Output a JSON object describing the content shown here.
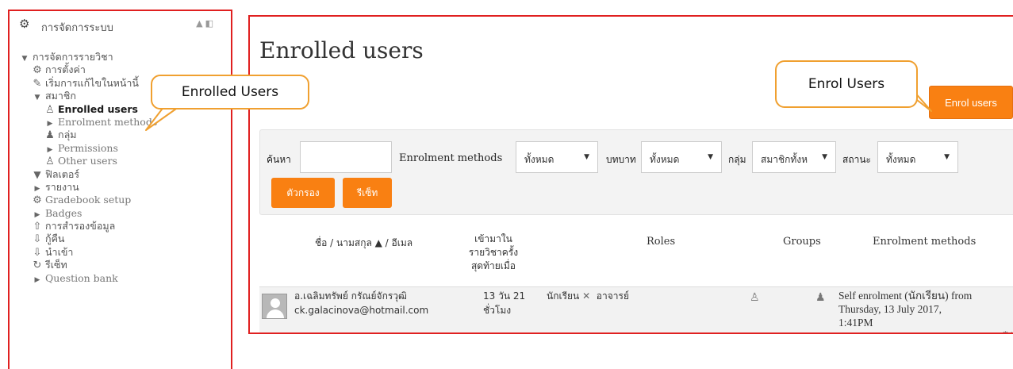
{
  "admin_panel": {
    "title": "การจัดการระบบ",
    "tree": [
      {
        "label": "การจัดการรายวิชา",
        "icon": "caret-down-icon",
        "level": 1
      },
      {
        "label": "การตั้งค่า",
        "icon": "gear-icon",
        "level": 2
      },
      {
        "label": "เริ่มการแก้ไขในหน้านี้",
        "icon": "pencil-icon",
        "level": 2
      },
      {
        "label": "สมาชิก",
        "icon": "caret-down-icon",
        "level": 2
      },
      {
        "label": "Enrolled users",
        "icon": "user-icon",
        "level": 3,
        "active": true
      },
      {
        "label": "Enrolment methods",
        "icon": "caret-right-icon",
        "level": 3
      },
      {
        "label": "กลุ่ม",
        "icon": "group-icon",
        "level": 3
      },
      {
        "label": "Permissions",
        "icon": "caret-right-icon",
        "level": 3
      },
      {
        "label": "Other users",
        "icon": "user-icon",
        "level": 3
      },
      {
        "label": "ฟิลเตอร์",
        "icon": "filter-icon",
        "level": 2
      },
      {
        "label": "รายงาน",
        "icon": "caret-right-icon",
        "level": 2
      },
      {
        "label": "Gradebook setup",
        "icon": "gear-icon",
        "level": 2
      },
      {
        "label": "Badges",
        "icon": "caret-right-icon",
        "level": 2
      },
      {
        "label": "การสำรองข้อมูล",
        "icon": "upload-icon",
        "level": 2
      },
      {
        "label": "กู้คืน",
        "icon": "download-icon",
        "level": 2
      },
      {
        "label": "นำเข้า",
        "icon": "download-icon",
        "level": 2
      },
      {
        "label": "รีเซ็ท",
        "icon": "reset-icon",
        "level": 2
      },
      {
        "label": "Question bank",
        "icon": "caret-right-icon",
        "level": 2
      }
    ]
  },
  "callouts": {
    "enrolled_users": "Enrolled Users",
    "enrol_users": "Enrol Users"
  },
  "main": {
    "title": "Enrolled users",
    "enrol_button": "Enrol users",
    "filters": {
      "search_label": "ค้นหา",
      "search_value": "",
      "methods_label": "Enrolment methods",
      "methods_value": "ทั้งหมด",
      "role_label": "บทบาท",
      "role_value": "ทั้งหมด",
      "group_label": "กลุ่ม",
      "group_value": "สมาชิกทั้งห",
      "status_label": "สถานะ",
      "status_value": "ทั้งหมด",
      "filter_button": "ตัวกรอง",
      "reset_button": "รีเซ็ท"
    },
    "table": {
      "headers": {
        "name": "ชื่อ / นามสกุล ▲ / อีเมล",
        "lastaccess": [
          "เข้ามาใน",
          "รายวิชาครั้ง",
          "สุดท้ายเมื่อ"
        ],
        "roles": "Roles",
        "groups": "Groups",
        "methods": "Enrolment methods"
      },
      "rows": [
        {
          "name": "อ.เฉลิมทรัพย์ กรัณย์จักรวุฒิ",
          "email": "ck.galacinova@hotmail.com",
          "lastaccess": [
            "13 วัน 21",
            "ชั่วโมง"
          ],
          "role_1": "นักเรียน",
          "role_2": "อาจารย์",
          "methods": [
            "Self enrolment (นักเรียน) from",
            "Thursday, 13 July 2017,",
            "1:41PM"
          ]
        }
      ]
    }
  },
  "colors": {
    "accent": "#f98012",
    "frame": "#e02020",
    "callout_border": "#f0a030"
  }
}
